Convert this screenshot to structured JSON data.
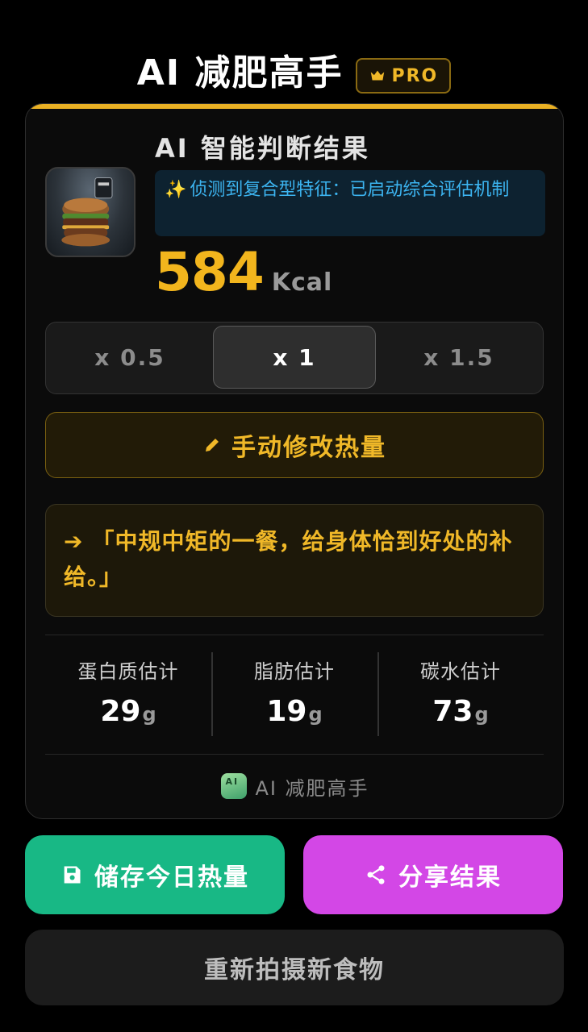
{
  "header": {
    "title": "AI 减肥高手",
    "pro_badge": "PRO"
  },
  "result": {
    "title": "AI 智能判断结果",
    "detection_note": "侦测到复合型特征：已启动综合评估机制",
    "calories": "584",
    "calories_unit": "Kcal"
  },
  "portion": {
    "options": [
      "x 0.5",
      "x 1",
      "x 1.5"
    ],
    "selected": "x 1"
  },
  "manual_edit_label": "手动修改热量",
  "comment": "「中规中矩的一餐，给身体恰到好处的补给。」",
  "macros": [
    {
      "label": "蛋白质估计",
      "value": "29",
      "unit": "g"
    },
    {
      "label": "脂肪估计",
      "value": "19",
      "unit": "g"
    },
    {
      "label": "碳水估计",
      "value": "73",
      "unit": "g"
    }
  ],
  "footer_brand": "AI 减肥高手",
  "actions": {
    "save_label": "储存今日热量",
    "share_label": "分享结果",
    "retake_label": "重新拍摄新食物"
  },
  "colors": {
    "accent_gold": "#f2b51d",
    "info_blue": "#3cb4f0",
    "save_green": "#18b885",
    "share_magenta": "#d347e6"
  },
  "icons": [
    "crown-icon",
    "sparkle-icon",
    "pencil-icon",
    "arrow-right-icon",
    "app-logo-icon",
    "save-icon",
    "share-icon"
  ]
}
